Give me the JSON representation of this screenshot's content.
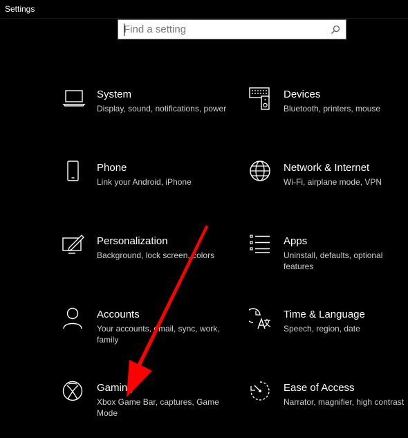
{
  "window": {
    "title": "Settings"
  },
  "search": {
    "placeholder": "Find a setting",
    "icon": "search-icon"
  },
  "tiles": [
    {
      "name": "System",
      "desc": "Display, sound, notifications, power",
      "icon": "laptop-icon"
    },
    {
      "name": "Devices",
      "desc": "Bluetooth, printers, mouse",
      "icon": "keyboard-speaker-icon"
    },
    {
      "name": "Phone",
      "desc": "Link your Android, iPhone",
      "icon": "phone-icon"
    },
    {
      "name": "Network & Internet",
      "desc": "Wi-Fi, airplane mode, VPN",
      "icon": "globe-icon"
    },
    {
      "name": "Personalization",
      "desc": "Background, lock screen, colors",
      "icon": "paint-monitor-icon"
    },
    {
      "name": "Apps",
      "desc": "Uninstall, defaults, optional features",
      "icon": "app-list-icon"
    },
    {
      "name": "Accounts",
      "desc": "Your accounts, email, sync, work, family",
      "icon": "person-icon"
    },
    {
      "name": "Time & Language",
      "desc": "Speech, region, date",
      "icon": "time-language-icon"
    },
    {
      "name": "Gaming",
      "desc": "Xbox Game Bar, captures, Game Mode",
      "icon": "xbox-icon"
    },
    {
      "name": "Ease of Access",
      "desc": "Narrator, magnifier, high contrast",
      "icon": "ease-of-access-icon"
    }
  ],
  "annotation": {
    "color": "#ff0000",
    "icon": "red-arrow-icon"
  }
}
